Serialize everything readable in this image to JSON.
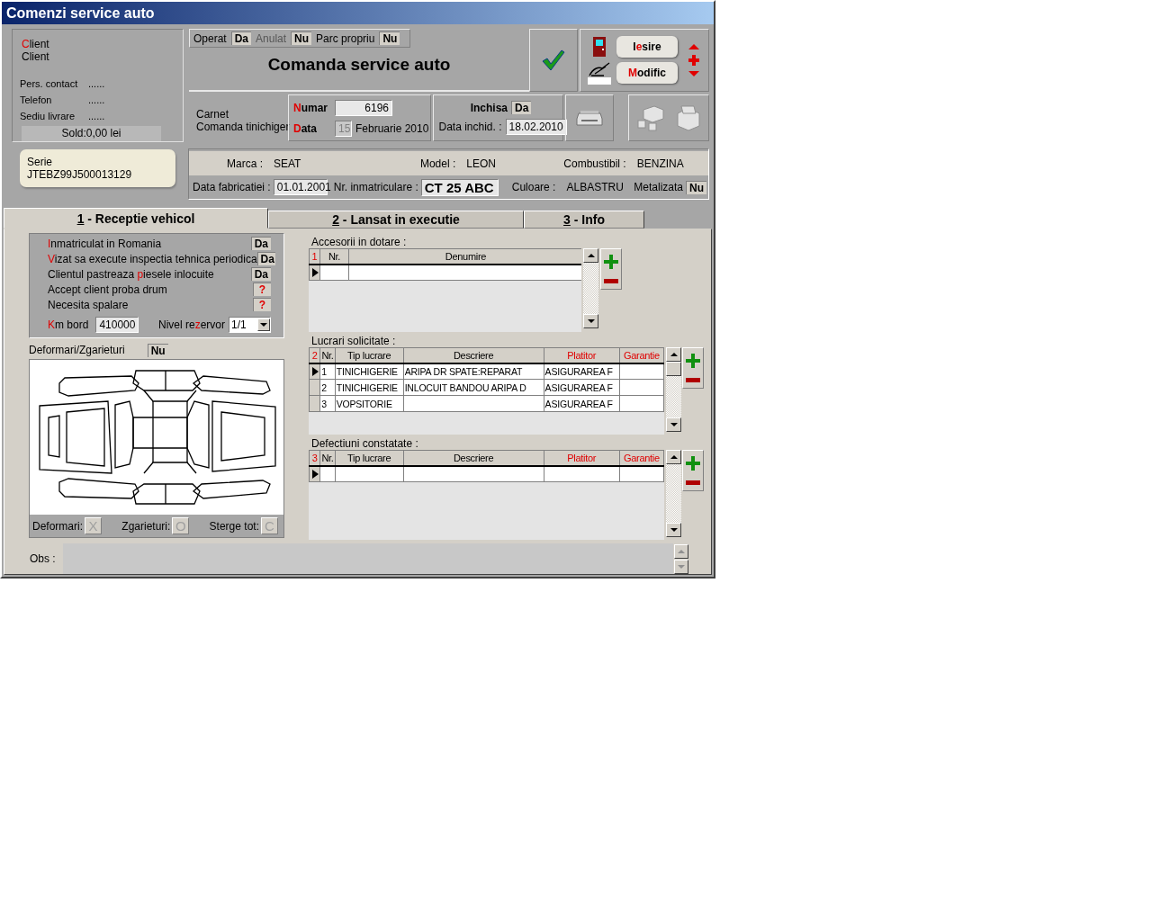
{
  "window": {
    "title": "Comenzi service auto"
  },
  "client": {
    "label": {
      "key": "C",
      "after": "lient"
    },
    "name": "Client",
    "contacts": [
      {
        "label": "Pers. contact",
        "value": "......"
      },
      {
        "label": "Telefon",
        "value": "......"
      },
      {
        "label": "Sediu livrare",
        "value": "......"
      }
    ],
    "balance": "Sold:0,00 lei"
  },
  "serie": {
    "label": "Serie",
    "value": "JTEBZ99J500013129"
  },
  "status": [
    {
      "label": "Operat",
      "value": "Da",
      "disabled": false
    },
    {
      "label": "Anulat",
      "value": "Nu",
      "disabled": true
    },
    {
      "label": "Parc propriu",
      "value": "Nu",
      "disabled": false
    }
  ],
  "heading": "Comanda service auto",
  "buttons": [
    {
      "kind": "exit",
      "before": "I",
      "key": "e",
      "after": "sire"
    },
    {
      "kind": "edit",
      "key": "M",
      "after": "odific"
    }
  ],
  "document": {
    "type_label": "Carnet",
    "type": "Comanda tinichiger",
    "number_label": {
      "key": "N",
      "after": "umar"
    },
    "number": "6196",
    "date_label": {
      "key": "D",
      "after": "ata"
    },
    "day": "15",
    "month": "Februarie 2010"
  },
  "closed": {
    "label": "Inchisa",
    "value": "Da",
    "date_label": "Data inchid. :",
    "date": "18.02.2010"
  },
  "vehicle": {
    "fields": [
      {
        "label": "Marca :",
        "value": "SEAT"
      },
      {
        "label": "Model :",
        "value": "LEON"
      },
      {
        "label": "Combustibil :",
        "value": "BENZINA"
      }
    ],
    "fabrication_label": "Data fabricatiei :",
    "fabrication": "01.01.2001",
    "plate_label": "Nr. inmatriculare :",
    "plate": "CT 25 ABC",
    "paint_label": "Culoare :",
    "paint": "ALBASTRU",
    "metallic_label": "Metalizata",
    "metallic": "Nu"
  },
  "tabs": [
    {
      "key": "1",
      "label": " - Receptie vehicol",
      "selected": true
    },
    {
      "key": "2",
      "label": " - Lansat in executie",
      "selected": false
    },
    {
      "key": "3",
      "label": " - Info",
      "selected": false
    }
  ],
  "checks": [
    {
      "key": "I",
      "after": "nmatriculat in Romania",
      "value": "Da",
      "set": true
    },
    {
      "key": "V",
      "after": "izat sa execute inspectia tehnica periodica",
      "value": "Da",
      "set": true
    },
    {
      "before": "Clientul pastreaza ",
      "key": "p",
      "after": "iesele inlocuite",
      "value": "Da",
      "set": true
    },
    {
      "after": "Accept client proba drum",
      "value": "?",
      "set": false
    },
    {
      "after": "Necesita spalare",
      "value": "?",
      "set": false
    }
  ],
  "km": {
    "label": {
      "key": "K",
      "after": "m bord"
    },
    "value": "410000"
  },
  "tank": {
    "label": {
      "before": "Nivel re",
      "key": "z",
      "after": "ervor"
    },
    "value": "1/1"
  },
  "damage": {
    "label": "Deformari/Zgarieturi",
    "value": "Nu",
    "tools": [
      {
        "label": "Deformari:",
        "key": "X"
      },
      {
        "label": "Zgarieturi:",
        "key": "O"
      },
      {
        "label": "Sterge tot:",
        "key": "C"
      }
    ]
  },
  "accessories": {
    "title": "Accesorii in dotare :",
    "index": "1",
    "columns": [
      {
        "label": "Nr.",
        "required": false
      },
      {
        "label": "Denumire",
        "required": false
      }
    ]
  },
  "works": {
    "title": "Lucrari solicitate :",
    "index": "2",
    "columns": [
      {
        "label": "Nr.",
        "required": false
      },
      {
        "label": "Tip lucrare",
        "required": false
      },
      {
        "label": "Descriere",
        "required": false
      },
      {
        "label": "Platitor",
        "required": true
      },
      {
        "label": "Garantie",
        "required": true
      }
    ],
    "rows": [
      {
        "cells": [
          "1",
          "TINICHIGERIE",
          "ARIPA DR SPATE:REPARAT",
          "ASIGURAREA F"
        ],
        "selected": true
      },
      {
        "cells": [
          "2",
          "TINICHIGERIE",
          "INLOCUIT BANDOU ARIPA D",
          "ASIGURAREA F"
        ],
        "selected": false
      },
      {
        "cells": [
          "3",
          "VOPSITORIE",
          "",
          "ASIGURAREA F"
        ],
        "selected": false
      }
    ]
  },
  "defects": {
    "title": "Defectiuni constatate :",
    "index": "3",
    "columns": [
      {
        "label": "Nr.",
        "required": false
      },
      {
        "label": "Tip lucrare",
        "required": false
      },
      {
        "label": "Descriere",
        "required": false
      },
      {
        "label": "Platitor",
        "required": true
      },
      {
        "label": "Garantie",
        "required": true
      }
    ]
  },
  "obs": {
    "label": "Obs :"
  }
}
